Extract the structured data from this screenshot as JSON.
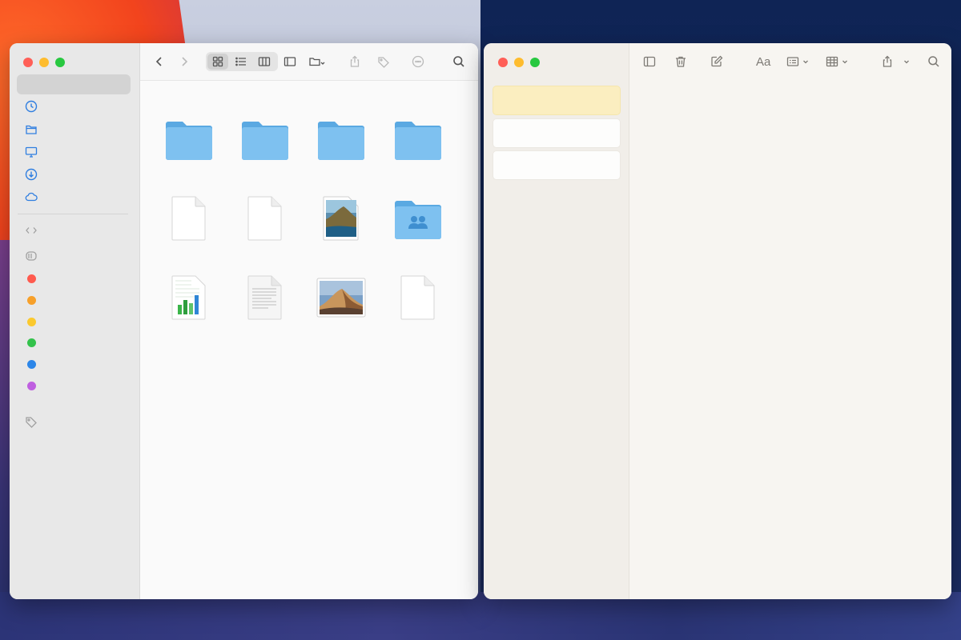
{
  "finder": {
    "sidebar": {
      "favorites": [
        {
          "icon": "recents-clock-icon"
        },
        {
          "icon": "documents-icon"
        },
        {
          "icon": "desktop-icon"
        },
        {
          "icon": "downloads-icon"
        },
        {
          "icon": "icloud-icon"
        }
      ],
      "locations": [
        {
          "icon": "network-icon"
        },
        {
          "icon": "disk-icon"
        }
      ],
      "tags": [
        {
          "color": "#ff5a4e"
        },
        {
          "color": "#f7a02a"
        },
        {
          "color": "#fbc92e"
        },
        {
          "color": "#33c24b"
        },
        {
          "color": "#2c86e8"
        },
        {
          "color": "#bf5fe0"
        }
      ],
      "all_tags_icon": "tag-icon"
    },
    "toolbar": {
      "buttons": [
        "back-icon",
        "forward-icon",
        "icon-view-icon",
        "list-view-icon",
        "column-view-icon",
        "gallery-view-icon",
        "group-icon",
        "share-icon",
        "tag-icon",
        "more-icon",
        "search-icon"
      ]
    },
    "files": [
      {
        "kind": "folder"
      },
      {
        "kind": "folder"
      },
      {
        "kind": "folder"
      },
      {
        "kind": "folder"
      },
      {
        "kind": "document"
      },
      {
        "kind": "document"
      },
      {
        "kind": "image-coast"
      },
      {
        "kind": "shared-folder"
      },
      {
        "kind": "spreadsheet"
      },
      {
        "kind": "text-document"
      },
      {
        "kind": "image-desert"
      },
      {
        "kind": "document"
      }
    ]
  },
  "notes": {
    "toolbar": {
      "format_label": "Aa",
      "buttons": [
        "sidebar-toggle-icon",
        "trash-icon",
        "compose-icon",
        "format-icon",
        "checklist-icon",
        "table-icon",
        "share-icon",
        "search-icon"
      ]
    },
    "note_list": [
      {
        "selected": true
      },
      {
        "selected": false
      },
      {
        "selected": false
      }
    ]
  },
  "colors": {
    "folder_blue": "#6cb4ea",
    "selection_yellow": "#fbeec0",
    "accent_blue": "#2f7ee0"
  }
}
